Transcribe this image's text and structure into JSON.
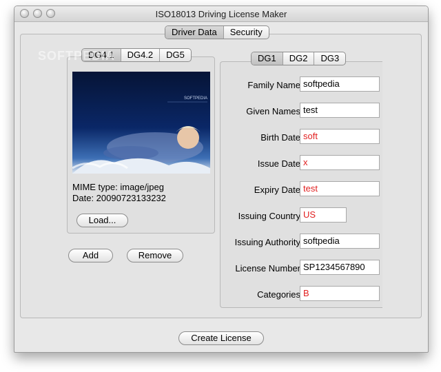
{
  "window": {
    "title": "ISO18013 Driving License Maker"
  },
  "main_tabs": [
    "Driver Data",
    "Security"
  ],
  "left_tabs": [
    "DG4.1",
    "DG4.2",
    "DG5"
  ],
  "right_tabs": [
    "DG1",
    "DG2",
    "DG3"
  ],
  "photo": {
    "mime_text": "MIME type: image/jpeg",
    "date_text": "Date: 20090723133232",
    "banner": "SOFTPEDIA"
  },
  "buttons": {
    "load": "Load...",
    "add": "Add",
    "remove": "Remove",
    "create": "Create License"
  },
  "fields": [
    {
      "label": "Family Name",
      "value": "softpedia",
      "color": "#000000"
    },
    {
      "label": "Given Names",
      "value": "test",
      "color": "#000000"
    },
    {
      "label": "Birth Date",
      "value": "soft",
      "color": "#e12020"
    },
    {
      "label": "Issue Date",
      "value": "x",
      "color": "#e12020"
    },
    {
      "label": "Expiry Date",
      "value": "test",
      "color": "#e12020"
    },
    {
      "label": "Issuing Country",
      "value": "US",
      "color": "#e12020"
    },
    {
      "label": "Issuing Authority",
      "value": "softpedia",
      "color": "#000000"
    },
    {
      "label": "License Number",
      "value": "SP1234567890",
      "color": "#000000"
    },
    {
      "label": "Categories",
      "value": "B",
      "color": "#e12020"
    }
  ],
  "watermark": "SOFTPEDIA"
}
